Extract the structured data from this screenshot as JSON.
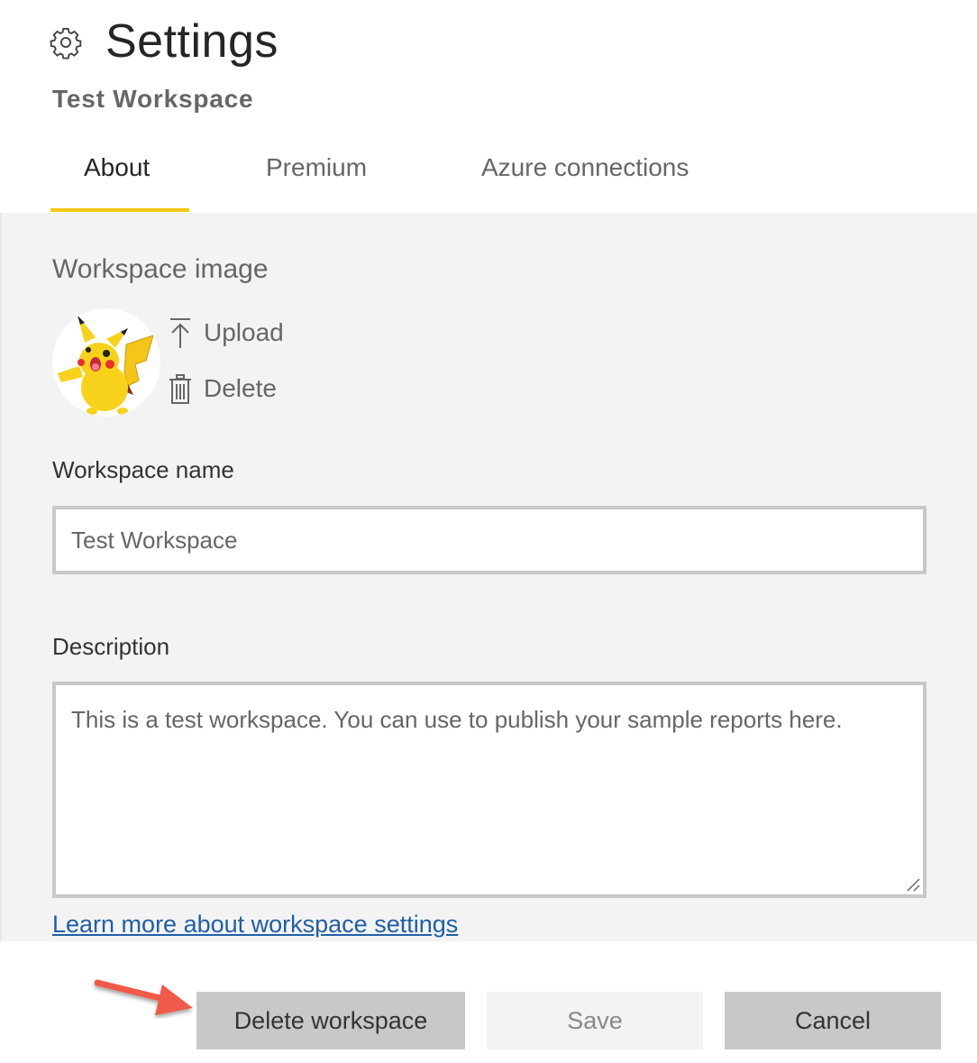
{
  "header": {
    "icon": "gear-icon",
    "title": "Settings",
    "subtitle": "Test Workspace"
  },
  "tabs": [
    {
      "label": "About",
      "active": true
    },
    {
      "label": "Premium",
      "active": false
    },
    {
      "label": "Azure connections",
      "active": false
    }
  ],
  "accent_color": "#f2c811",
  "about": {
    "image_section_label": "Workspace image",
    "image_alt": "Pikachu workspace avatar",
    "upload_label": "Upload",
    "delete_label": "Delete",
    "name_label": "Workspace name",
    "name_value": "Test Workspace",
    "description_label": "Description",
    "description_value": "This is a test workspace. You can use to publish your sample reports here.",
    "learn_more_link": "Learn more about workspace settings"
  },
  "footer": {
    "delete_workspace_label": "Delete workspace",
    "save_label": "Save",
    "cancel_label": "Cancel"
  },
  "annotation": {
    "arrow_color": "#f05a4a",
    "points_to": "Delete workspace"
  }
}
